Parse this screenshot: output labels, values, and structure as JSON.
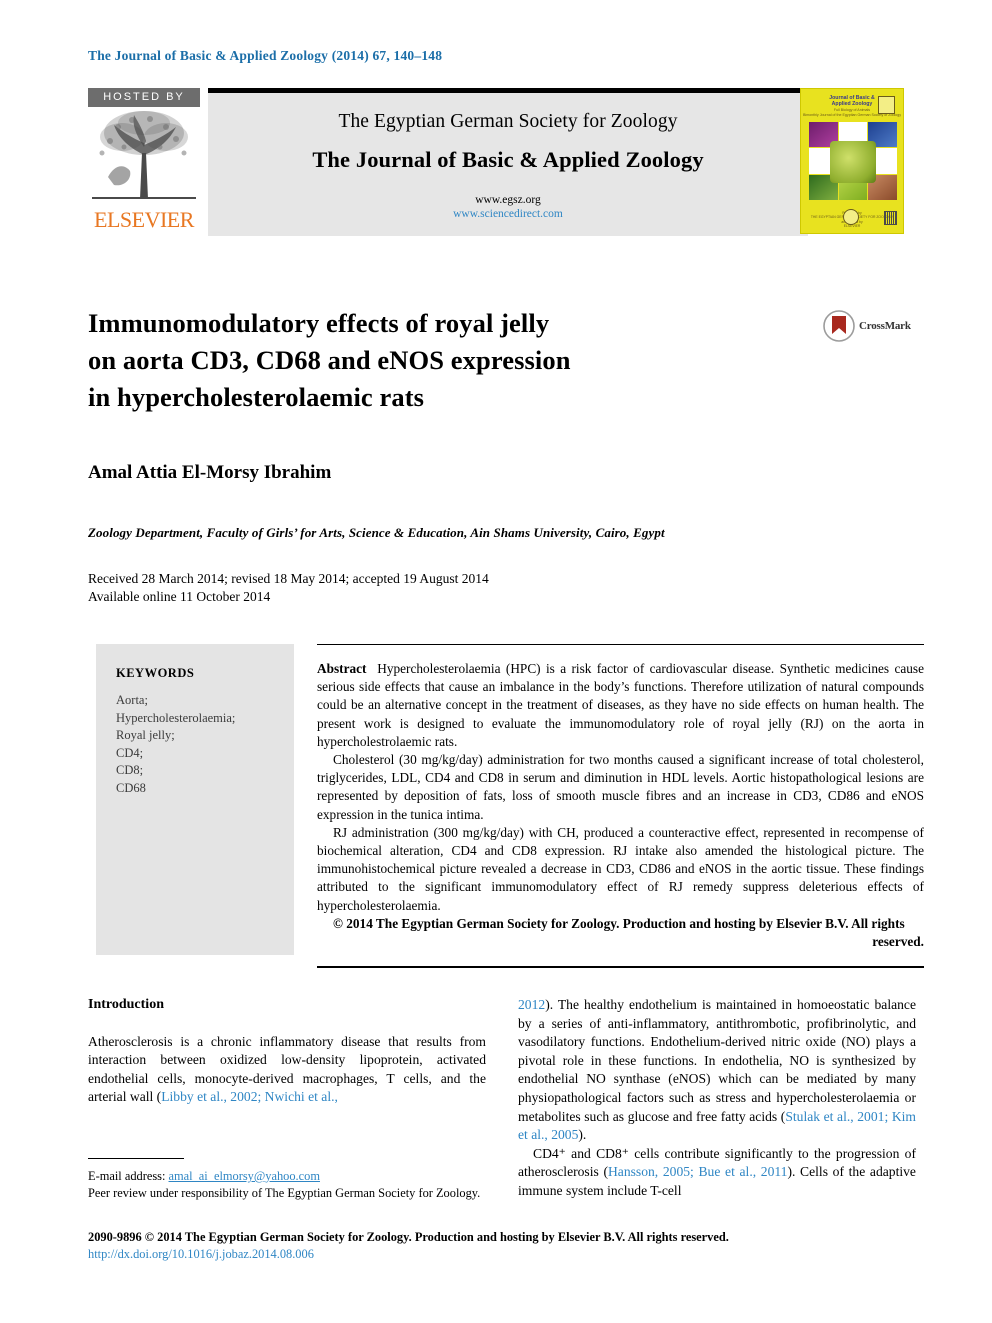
{
  "running_head": "The Journal of Basic & Applied Zoology (2014) 67, 140–148",
  "masthead": {
    "hosted_by": "HOSTED BY",
    "publisher": "ELSEVIER",
    "society": "The Egyptian German Society for Zoology",
    "journal_title": "The Journal of Basic & Applied Zoology",
    "url_society": "www.egsz.org",
    "url_sciencedirect": "www.sciencedirect.com",
    "cover": {
      "title": "Journal of Basic &\nApplied Zoology",
      "subtitle": "Full Biology of Animals",
      "sub2": "Bimonthly Journal of the Egyptian German Society of Zoology",
      "footer": "Published by\nTHE EGYPTIAN GERMAN SOCIETY FOR ZOOLOGY\nand hosted by\nELSEVIER"
    }
  },
  "article": {
    "title_line1": "Immunomodulatory effects of royal jelly",
    "title_line2": "on aorta CD3, CD68 and eNOS expression",
    "title_line3": "in hypercholesterolaemic rats",
    "crossmark_label": "CrossMark",
    "author": "Amal Attia El-Morsy Ibrahim",
    "affiliation": "Zoology Department, Faculty of Girls’ for Arts, Science & Education, Ain Shams University, Cairo, Egypt",
    "received": "Received 28 March 2014; revised 18 May 2014; accepted 19 August 2014",
    "available": "Available online 11 October 2014"
  },
  "keywords": {
    "heading": "KEYWORDS",
    "items": [
      "Aorta;",
      "Hypercholesterolaemia;",
      "Royal jelly;",
      "CD4;",
      "CD8;",
      "CD68"
    ]
  },
  "abstract": {
    "label": "Abstract",
    "p1": "Hypercholesterolaemia (HPC) is a risk factor of cardiovascular disease. Synthetic medicines cause serious side effects that cause an imbalance in the body’s functions. Therefore utilization of natural compounds could be an alternative concept in the treatment of diseases, as they have no side effects on human health. The present work is designed to evaluate the immunomodulatory role of royal jelly (RJ) on the aorta in hypercholestrolaemic rats.",
    "p2": "Cholesterol (30 mg/kg/day) administration for two months caused a significant increase of total cholesterol, triglycerides, LDL, CD4 and CD8 in serum and diminution in HDL levels. Aortic histopathological lesions are represented by deposition of fats, loss of smooth muscle fibres and an increase in CD3, CD86 and eNOS expression in the tunica intima.",
    "p3": "RJ administration (300 mg/kg/day) with CH, produced a counteractive effect, represented in recompense of biochemical alteration, CD4 and CD8 expression. RJ intake also amended the histological picture. The immunohistochemical picture revealed a decrease in CD3, CD86 and eNOS in the aortic tissue. These findings attributed to the significant immunomodulatory effect of RJ remedy suppress deleterious effects of hypercholesterolaemia.",
    "copyright": "© 2014 The Egyptian German Society for Zoology. Production and hosting by Elsevier B.V. All rights",
    "copyright_tail": "reserved."
  },
  "body": {
    "intro_heading": "Introduction",
    "left_p1_a": "Atherosclerosis is a chronic inflammatory disease that results from interaction between oxidized low-density lipoprotein, activated endothelial cells, monocyte-derived macrophages, T cells, and the arterial wall (",
    "left_p1_ref": "Libby et al., 2002; Nwichi et al.,",
    "right_p1_ref": "2012",
    "right_p1_a": "). The healthy endothelium is maintained in homoeostatic balance by a series of anti-inflammatory, antithrombotic, profibrinolytic, and vasodilatory functions. Endothelium-derived nitric oxide (NO) plays a pivotal role in these functions. In endothelia, NO is synthesized by endothelial NO synthase (eNOS) which can be mediated by many physiopathological factors such as stress and hypercholesterolaemia or metabolites such as glucose and free fatty acids (",
    "right_p1_ref2": "Stulak et al., 2001; Kim et al., 2005",
    "right_p1_b": ").",
    "right_p2_a": "CD4⁺ and CD8⁺ cells contribute significantly to the progression of atherosclerosis (",
    "right_p2_ref": "Hansson, 2005; Bue et al., 2011",
    "right_p2_b": "). Cells of the adaptive immune system include T-cell"
  },
  "footnote": {
    "email_label": "E-mail address:",
    "email": "amal_ai_elmorsy@yahoo.com",
    "peer_review": "Peer review under responsibility of The Egyptian German Society for Zoology."
  },
  "publisher_footer": {
    "line1": "2090-9896 © 2014 The Egyptian German Society for Zoology. Production and hosting by Elsevier B.V. All rights reserved.",
    "doi": "http://dx.doi.org/10.1016/j.jobaz.2014.08.006"
  },
  "colors": {
    "link": "#2f86c4",
    "running_head": "#1b6ea8",
    "elsevier_orange": "#E87722",
    "panel_gray": "#e6e6e6",
    "keyword_gray": "#e4e4e4",
    "cover_yellow": "#e8e21f"
  }
}
